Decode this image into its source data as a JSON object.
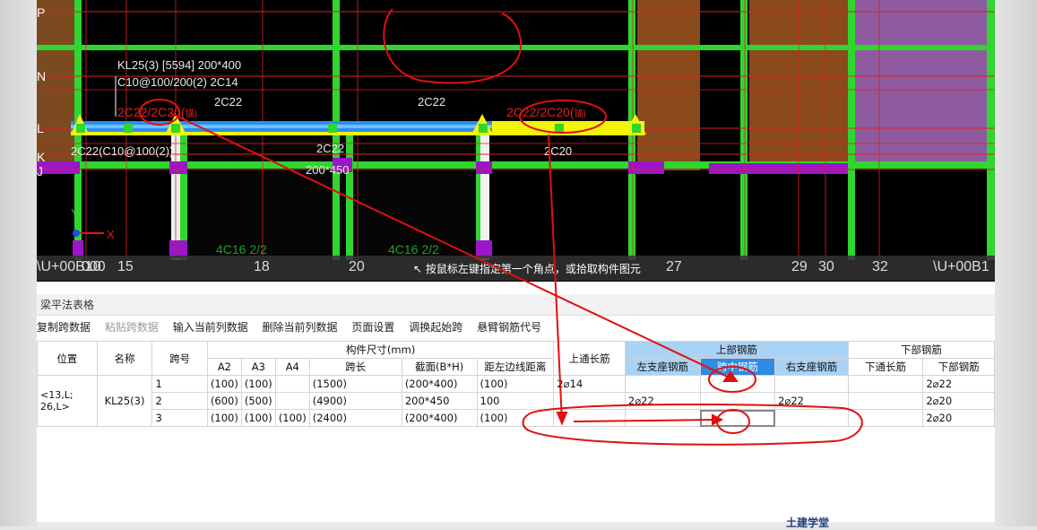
{
  "cad": {
    "grid_rows": [
      "P",
      "N",
      "L",
      "K",
      "J"
    ],
    "beam_name": "KL25(3) [5594] 200*400",
    "beam_stirrup": "C10@100/200(2) 2C14",
    "top_bar_left": "2C22",
    "top_bar_mid": "2C22",
    "red_note_1": "2C22/2C20(",
    "red_note_1_suffix": "锚)",
    "red_note_2": "2C22/2C20(",
    "red_note_2_suffix": "锚)",
    "lower_note": "2C22(C10@100(2))",
    "span_mid_label": "2C22",
    "span_mid_size": "200*450",
    "right_bar": "2C20",
    "left_rebar": "4C16 2/2",
    "mid_rebar": "4C16 2/2",
    "axis_x": "X",
    "axis_y": "Y",
    "hint": "按鼠标左键指定第一个角点，或拾取构件图元",
    "axis_labels": [
      "\\U+00B10",
      "000",
      "15",
      "18",
      "20",
      "27",
      "29",
      "30",
      "32",
      "\\U+00B1"
    ]
  },
  "panel": {
    "title": "梁平法表格",
    "toolbar": [
      "复制跨数据",
      "粘贴跨数据",
      "输入当前列数据",
      "删除当前列数据",
      "页面设置",
      "调换起始跨",
      "悬臂钢筋代号"
    ],
    "headers": {
      "position": "位置",
      "name": "名称",
      "span_no": "跨号",
      "dims_group": "构件尺寸(mm)",
      "a2": "A2",
      "a3": "A3",
      "a4": "A4",
      "span_len": "跨长",
      "section": "截面(B*H)",
      "offset": "距左边线距离",
      "top_through": "上通长筋",
      "top_group": "上部钢筋",
      "left_support": "左支座钢筋",
      "mid_span": "跨中钢筋",
      "right_support": "右支座钢筋",
      "bottom_group": "下部钢筋",
      "bottom_through": "下通长筋",
      "bottom_rebar": "下部钢筋"
    },
    "position_value": "<13,L; 26,L>",
    "name_value": "KL25(3)",
    "rows": [
      {
        "span": "1",
        "a2": "(100)",
        "a3": "(100)",
        "a4": "",
        "len": "(1500)",
        "section": "(200*400)",
        "offset": "(100)",
        "top_through": "2⌀14",
        "left": "",
        "mid": "",
        "right": "",
        "bottom_through": "",
        "bottom": "2⌀22"
      },
      {
        "span": "2",
        "a2": "(600)",
        "a3": "(500)",
        "a4": "",
        "len": "(4900)",
        "section": "200*450",
        "offset": "100",
        "top_through": "",
        "left": "2⌀22",
        "mid": "",
        "right": "2⌀22",
        "bottom_through": "",
        "bottom": "2⌀20"
      },
      {
        "span": "3",
        "a2": "(100)",
        "a3": "(100)",
        "a4": "(100)",
        "len": "(2400)",
        "section": "(200*400)",
        "offset": "(100)",
        "top_through": "",
        "left": "",
        "mid": "",
        "right": "",
        "bottom_through": "",
        "bottom": "2⌀20"
      }
    ]
  },
  "bottom": {
    "brand": "土建学堂"
  }
}
